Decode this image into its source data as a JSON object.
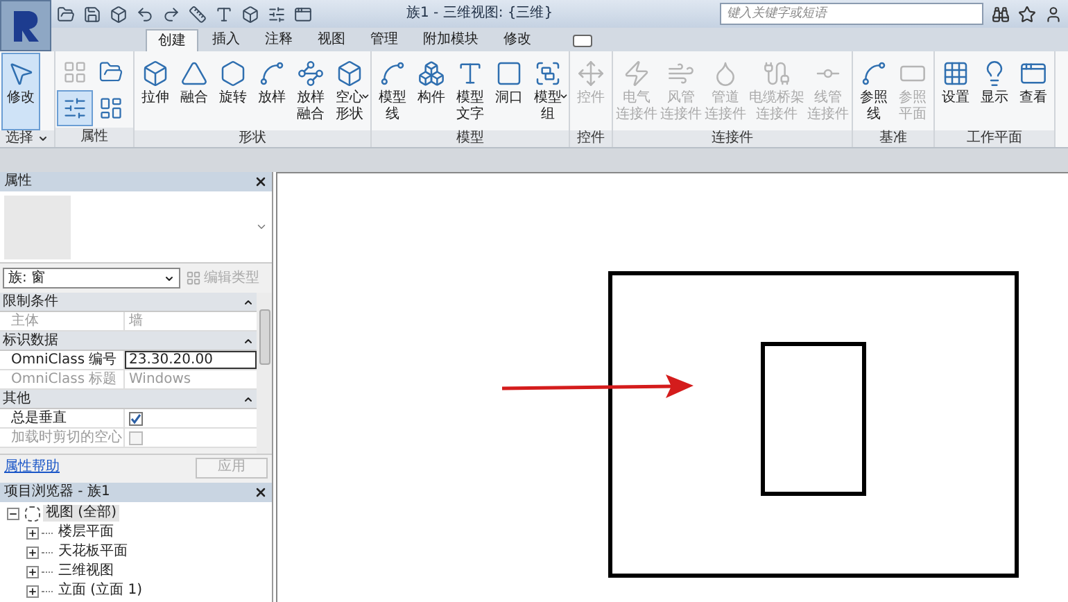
{
  "window": {
    "title": "族1 - 三维视图: {三维}"
  },
  "search": {
    "placeholder": "键入关键字或短语"
  },
  "tabs": [
    {
      "label": "创建",
      "selected": true
    },
    {
      "label": "插入",
      "selected": false
    },
    {
      "label": "注释",
      "selected": false
    },
    {
      "label": "视图",
      "selected": false
    },
    {
      "label": "管理",
      "selected": false
    },
    {
      "label": "附加模块",
      "selected": false
    },
    {
      "label": "修改",
      "selected": false
    }
  ],
  "ribbon": {
    "groups": [
      {
        "label": "选择",
        "dropdown": true,
        "tools": [
          {
            "kind": "large",
            "lines": [
              "修改"
            ],
            "selected": true,
            "disabled": false,
            "dropdown": false
          }
        ]
      },
      {
        "label": "属性",
        "dropdown": false,
        "tools": [
          {
            "kind": "small",
            "selected": false,
            "disabled": true
          },
          {
            "kind": "small",
            "selected": false,
            "disabled": false
          },
          {
            "kind": "small",
            "selected": true,
            "disabled": false
          },
          {
            "kind": "small",
            "selected": false,
            "disabled": false
          }
        ]
      },
      {
        "label": "形状",
        "dropdown": false,
        "tools": [
          {
            "kind": "large",
            "lines": [
              "拉伸"
            ],
            "selected": false,
            "disabled": false,
            "dropdown": false
          },
          {
            "kind": "large",
            "lines": [
              "融合"
            ],
            "selected": false,
            "disabled": false,
            "dropdown": false
          },
          {
            "kind": "large",
            "lines": [
              "旋转"
            ],
            "selected": false,
            "disabled": false,
            "dropdown": false
          },
          {
            "kind": "large",
            "lines": [
              "放样"
            ],
            "selected": false,
            "disabled": false,
            "dropdown": false
          },
          {
            "kind": "large",
            "lines": [
              "放样",
              "融合"
            ],
            "selected": false,
            "disabled": false,
            "dropdown": false
          },
          {
            "kind": "large",
            "lines": [
              "空心",
              "形状"
            ],
            "selected": false,
            "disabled": false,
            "dropdown": true
          }
        ]
      },
      {
        "label": "模型",
        "dropdown": false,
        "tools": [
          {
            "kind": "large",
            "lines": [
              "模型",
              "线"
            ],
            "selected": false,
            "disabled": false,
            "dropdown": false
          },
          {
            "kind": "large",
            "lines": [
              "构件"
            ],
            "selected": false,
            "disabled": false,
            "dropdown": false
          },
          {
            "kind": "large",
            "lines": [
              "模型",
              "文字"
            ],
            "selected": false,
            "disabled": false,
            "dropdown": false
          },
          {
            "kind": "large",
            "lines": [
              "洞口"
            ],
            "selected": false,
            "disabled": false,
            "dropdown": false
          },
          {
            "kind": "large",
            "lines": [
              "模型",
              "组"
            ],
            "selected": false,
            "disabled": false,
            "dropdown": true
          }
        ]
      },
      {
        "label": "控件",
        "dropdown": false,
        "tools": [
          {
            "kind": "large",
            "lines": [
              "控件"
            ],
            "selected": false,
            "disabled": true,
            "dropdown": false
          }
        ]
      },
      {
        "label": "连接件",
        "dropdown": false,
        "tools": [
          {
            "kind": "large",
            "lines": [
              "电气",
              "连接件"
            ],
            "selected": false,
            "disabled": true,
            "dropdown": false
          },
          {
            "kind": "large",
            "lines": [
              "风管",
              "连接件"
            ],
            "selected": false,
            "disabled": true,
            "dropdown": false
          },
          {
            "kind": "large",
            "lines": [
              "管道",
              "连接件"
            ],
            "selected": false,
            "disabled": true,
            "dropdown": false
          },
          {
            "kind": "large",
            "lines": [
              "电缆桥架",
              "连接件"
            ],
            "selected": false,
            "disabled": true,
            "dropdown": false
          },
          {
            "kind": "large",
            "lines": [
              "线管",
              "连接件"
            ],
            "selected": false,
            "disabled": true,
            "dropdown": false
          }
        ]
      },
      {
        "label": "基准",
        "dropdown": false,
        "tools": [
          {
            "kind": "large",
            "lines": [
              "参照",
              "线"
            ],
            "selected": false,
            "disabled": false,
            "dropdown": false
          },
          {
            "kind": "large",
            "lines": [
              "参照",
              "平面"
            ],
            "selected": false,
            "disabled": true,
            "dropdown": false
          }
        ]
      },
      {
        "label": "工作平面",
        "dropdown": false,
        "tools": [
          {
            "kind": "large",
            "lines": [
              "设置"
            ],
            "selected": false,
            "disabled": false,
            "dropdown": false
          },
          {
            "kind": "large",
            "lines": [
              "显示"
            ],
            "selected": false,
            "disabled": false,
            "dropdown": false
          },
          {
            "kind": "large",
            "lines": [
              "查看"
            ],
            "selected": false,
            "disabled": false,
            "dropdown": false
          }
        ]
      }
    ]
  },
  "properties": {
    "title": "属性",
    "type_selector": "族: 窗",
    "edit_type": {
      "label": "编辑类型",
      "disabled": true
    },
    "groups": [
      {
        "label": "限制条件",
        "rows": [
          {
            "kind": "text",
            "name": "主体",
            "value": "墙",
            "disabled": true
          }
        ]
      },
      {
        "label": "标识数据",
        "rows": [
          {
            "kind": "field",
            "name": "OmniClass 编号",
            "value": "23.30.20.00",
            "disabled": false
          },
          {
            "kind": "text",
            "name": "OmniClass 标题",
            "value": "Windows",
            "disabled": true
          }
        ]
      },
      {
        "label": "其他",
        "rows": [
          {
            "kind": "checkbox",
            "name": "总是垂直",
            "checked": true,
            "disabled": false
          },
          {
            "kind": "checkbox",
            "name": "加载时剪切的空心",
            "checked": false,
            "disabled": true
          }
        ]
      }
    ],
    "help_link": "属性帮助",
    "apply": {
      "label": "应用",
      "disabled": true
    }
  },
  "project_browser": {
    "title": "项目浏览器 - 族1",
    "tree": [
      {
        "label": "视图 (全部)",
        "expanded": true,
        "selected": true,
        "children": [
          {
            "label": "楼层平面",
            "expanded": false,
            "selected": false
          },
          {
            "label": "天花板平面",
            "expanded": false,
            "selected": false
          },
          {
            "label": "三维视图",
            "expanded": false,
            "selected": false
          },
          {
            "label": "立面 (立面 1)",
            "expanded": false,
            "selected": false
          }
        ]
      }
    ]
  }
}
